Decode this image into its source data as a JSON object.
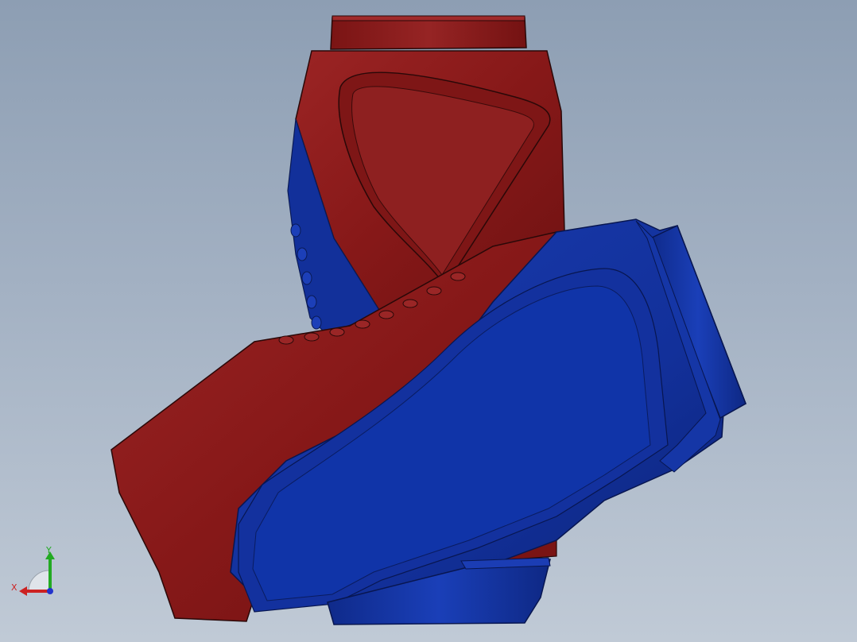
{
  "viewport": {
    "background_top": "#8d9eb3",
    "background_bottom": "#c0cad6"
  },
  "model": {
    "face_colors": {
      "red_body": "#8a1c1c",
      "red_highlight": "#a32a2a",
      "red_shadow": "#6a1010",
      "blue_body": "#12309a",
      "blue_highlight": "#1f46c2",
      "blue_shadow": "#0b2070",
      "edge": "#1a0606"
    }
  },
  "triad": {
    "x_label": "X",
    "y_label": "Y",
    "x_color": "#cc2222",
    "y_color": "#22aa22",
    "z_color": "#2233cc",
    "icon": "coordinate-triad-icon"
  }
}
